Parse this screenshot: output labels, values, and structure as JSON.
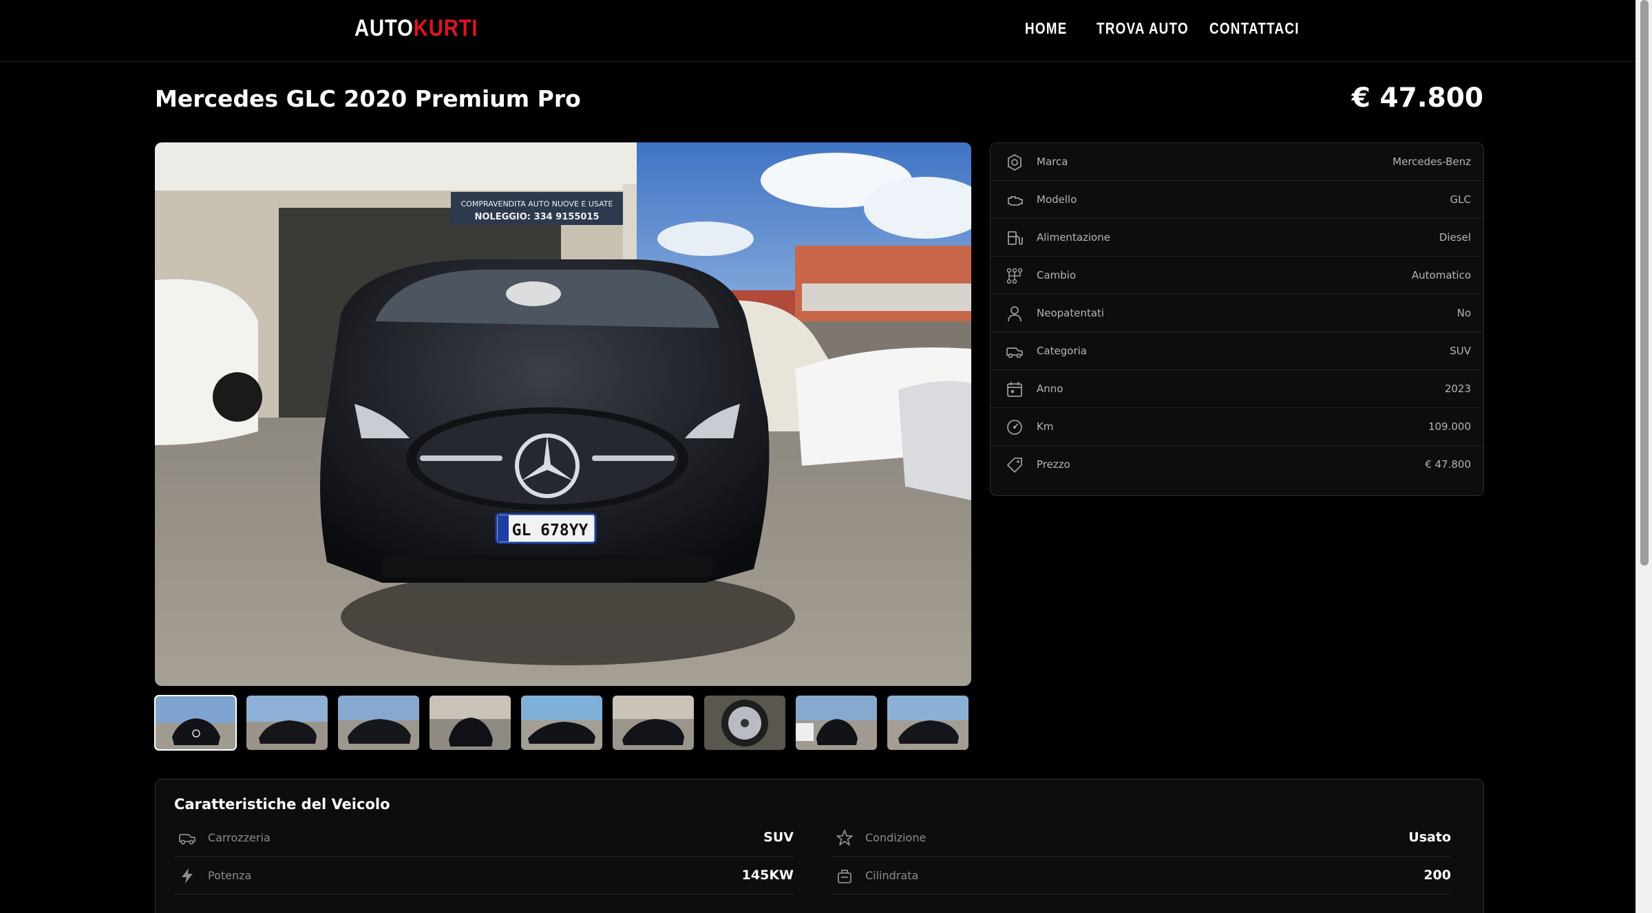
{
  "nav": {
    "logo_part1": "AUTO",
    "logo_part2": "KURTI",
    "items": [
      "HOME",
      "TROVA AUTO",
      "CONTATTACI"
    ]
  },
  "listing": {
    "title": "Mercedes GLC 2020 Premium Pro",
    "price": "€ 47.800"
  },
  "gallery": {
    "main_photo": {
      "sign_line1": "COMPRAVENDITA AUTO NUOVE E USATE",
      "sign_line2": "NOLEGGIO: 334 9155015",
      "plate": "GL 678YY"
    },
    "thumbnail_count": 9,
    "active_index": 0
  },
  "specs": [
    {
      "icon": "brand-icon",
      "label": "Marca",
      "value": "Mercedes-Benz"
    },
    {
      "icon": "engine-icon",
      "label": "Modello",
      "value": "GLC"
    },
    {
      "icon": "fuel-icon",
      "label": "Alimentazione",
      "value": "Diesel"
    },
    {
      "icon": "gearbox-icon",
      "label": "Cambio",
      "value": "Automatico"
    },
    {
      "icon": "user-icon",
      "label": "Neopatentati",
      "value": "No"
    },
    {
      "icon": "car-icon",
      "label": "Categoria",
      "value": "SUV"
    },
    {
      "icon": "calendar-icon",
      "label": "Anno",
      "value": "2023"
    },
    {
      "icon": "speedometer-icon",
      "label": "Km",
      "value": "109.000"
    },
    {
      "icon": "tag-icon",
      "label": "Prezzo",
      "value": "€ 47.800"
    }
  ],
  "features": {
    "title": "Caratteristiche del Veicolo",
    "items": [
      {
        "icon": "car-icon",
        "label": "Carrozzeria",
        "value": "SUV"
      },
      {
        "icon": "star-icon",
        "label": "Condizione",
        "value": "Usato"
      },
      {
        "icon": "bolt-icon",
        "label": "Potenza",
        "value": "145KW"
      },
      {
        "icon": "engine-block-icon",
        "label": "Cilindrata",
        "value": "200"
      }
    ]
  }
}
